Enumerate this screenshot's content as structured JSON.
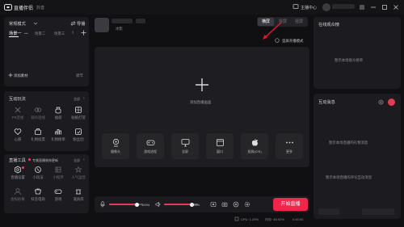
{
  "app": {
    "title": "直播伴侣",
    "subtitle": "抖音",
    "menu_user": "主播中心"
  },
  "scenes": {
    "mode_label": "常规模式",
    "mode_action": "导播",
    "tabs": [
      "场景一",
      "场景二",
      "场景三"
    ],
    "add_material": "添加素材",
    "adjust": "调节"
  },
  "interactive": {
    "title": "互动玩法",
    "all": "全部",
    "items": [
      "PK连线",
      "观众连线",
      "福袋",
      "贴纸打赏",
      "心愿",
      "礼物投票",
      "礼物榜单",
      "粉丝团"
    ]
  },
  "live_tools": {
    "title": "直播工具",
    "notice": "专属直播装饰更新",
    "all": "全部",
    "items": [
      "直播设置",
      "小玩法",
      "小程序",
      "人气运营",
      "虚拟形象",
      "抖音电商",
      "游戏",
      "道具库"
    ]
  },
  "stream": {
    "username": "冰影",
    "orientation_tabs": [
      "横屏",
      "竖屏",
      "竖屏"
    ],
    "dual_mode": "竖屏开播模式",
    "add_screen": "添加直播画面",
    "sources": [
      "摄像头",
      "游戏进程",
      "全屏",
      "窗口",
      "投屏(iOS)",
      "更多"
    ]
  },
  "audio": {
    "mic_value": "100%",
    "speaker_value": "100%",
    "mic_level": 0.82,
    "speaker_level": 0.82
  },
  "start_button": "开始直播",
  "status": {
    "cpu": "CPU: 1.29%",
    "memory": "内存: 48.92%",
    "fps": "0:00:00"
  },
  "viewers": {
    "title": "在线观众榜",
    "empty": "暂示本场观众榜单"
  },
  "messages": {
    "title": "互动消息",
    "gift_empty": "暂示本场直播的礼物消息",
    "comment_empty": "暂示本场直播的评论互动消息"
  },
  "colors": {
    "accent": "#ff3b5c",
    "start": "#f2254a",
    "panel": "#1c1c20",
    "bg": "#101012"
  }
}
